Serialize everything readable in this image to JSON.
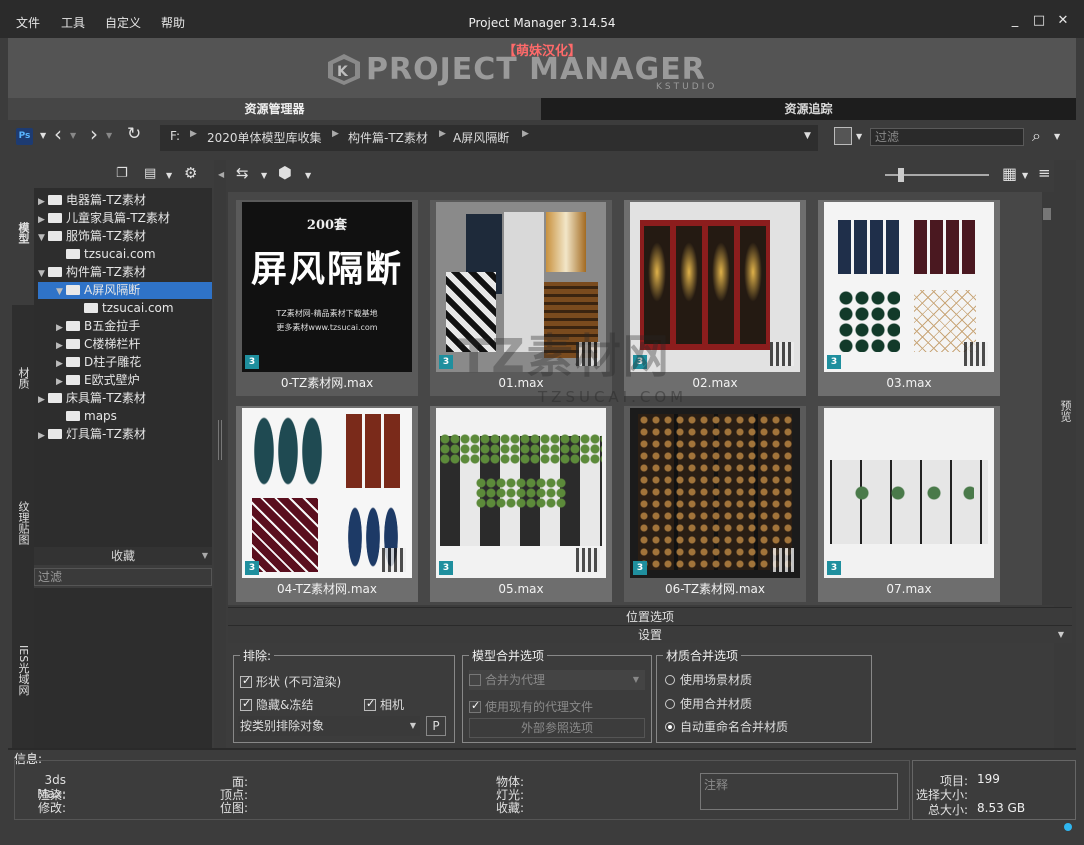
{
  "window": {
    "title": "Project Manager 3.14.54",
    "controls": [
      "_",
      "□",
      "✕"
    ]
  },
  "menu": [
    "文件",
    "工具",
    "自定义",
    "帮助"
  ],
  "banner": {
    "sub": "【萌妹汉化】",
    "logo": "PROJECT MANAGER",
    "kstudio": "KSTUDIO"
  },
  "tabs": [
    "资源管理器",
    "资源追踪"
  ],
  "toolbar": {
    "ps_label": "Ps",
    "filter_placeholder": "过滤"
  },
  "breadcrumb": [
    "F:",
    "2020单体模型库收集",
    "构件篇-TZ素材",
    "A屏风隔断"
  ],
  "left_tabs": [
    "模型",
    "材质",
    "纹理贴图",
    "IES光域网"
  ],
  "tree": [
    {
      "label": "电器篇-TZ素材",
      "level": 0,
      "arrow": "▶"
    },
    {
      "label": "儿童家具篇-TZ素材",
      "level": 0,
      "arrow": "▶"
    },
    {
      "label": "服饰篇-TZ素材",
      "level": 0,
      "arrow": "▼"
    },
    {
      "label": "tzsucai.com",
      "level": 1,
      "arrow": ""
    },
    {
      "label": "构件篇-TZ素材",
      "level": 0,
      "arrow": "▼"
    },
    {
      "label": "A屏风隔断",
      "level": 1,
      "arrow": "▼",
      "selected": true
    },
    {
      "label": "tzsucai.com",
      "level": 2,
      "arrow": ""
    },
    {
      "label": "B五金拉手",
      "level": 1,
      "arrow": "▶"
    },
    {
      "label": "C楼梯栏杆",
      "level": 1,
      "arrow": "▶"
    },
    {
      "label": "D柱子雕花",
      "level": 1,
      "arrow": "▶"
    },
    {
      "label": "E欧式壁炉",
      "level": 1,
      "arrow": "▶"
    },
    {
      "label": "床具篇-TZ素材",
      "level": 0,
      "arrow": "▶"
    },
    {
      "label": "maps",
      "level": 1,
      "arrow": ""
    },
    {
      "label": "灯具篇-TZ素材",
      "level": 0,
      "arrow": "▶"
    }
  ],
  "favorites": {
    "header": "收藏",
    "filter_placeholder": "过滤"
  },
  "files": [
    {
      "name": "0-TZ素材网.max",
      "cover_title": "屏风隔断",
      "cover_count": "200套",
      "cover_line1": "TZ素材网-精品素材下载基地",
      "cover_line2": "更多素材www.tzsucai.com"
    },
    {
      "name": "01.max"
    },
    {
      "name": "02.max"
    },
    {
      "name": "03.max"
    },
    {
      "name": "04-TZ素材网.max"
    },
    {
      "name": "05.max"
    },
    {
      "name": "06-TZ素材网.max"
    },
    {
      "name": "07.max"
    }
  ],
  "watermark": {
    "main": "TZ素材网",
    "sub": "TZSUCAI.COM"
  },
  "sections": {
    "position": "位置选项",
    "settings": "设置"
  },
  "exclude": {
    "title": "排除:",
    "shape": "形状 (不可渲染)",
    "hidden": "隐藏&冻结",
    "camera": "相机",
    "by_type": "按类别排除对象",
    "p_button": "P"
  },
  "model_merge": {
    "title": "模型合并选项",
    "merge_proxy": "合并为代理",
    "use_existing": "使用现有的代理文件",
    "xref": "外部参照选项"
  },
  "material_merge": {
    "title": "材质合并选项",
    "opt1": "使用场景材质",
    "opt2": "使用合并材质",
    "opt3": "自动重命名合并材质"
  },
  "info": {
    "title": "信息:",
    "col1": [
      "3ds Max:",
      "渲染:",
      "修改:"
    ],
    "col2": [
      "面:",
      "顶点:",
      "位图:"
    ],
    "col3": [
      "物体:",
      "灯光:",
      "收藏:"
    ],
    "notes_placeholder": "注释"
  },
  "stats": {
    "items_label": "项目:",
    "items_value": "199",
    "sel_label": "选择大小:",
    "total_label": "总大小:",
    "total_value": "8.53 GB"
  },
  "right_tab": "预览"
}
